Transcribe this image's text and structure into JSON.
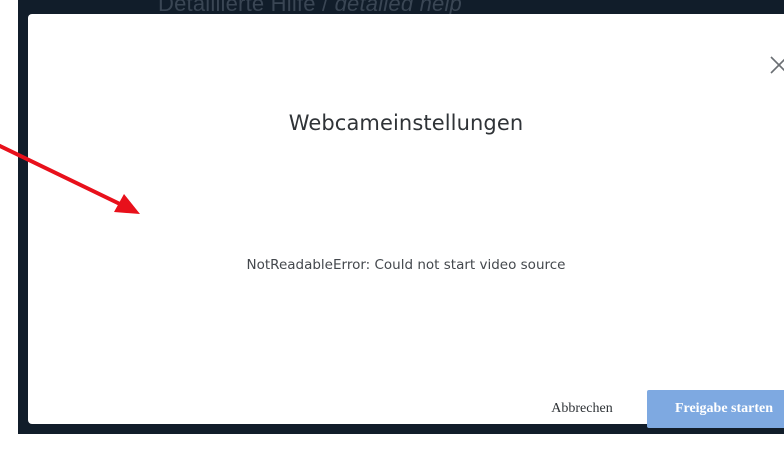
{
  "background": {
    "heading_part1": "Detaillierte Hilfe / ",
    "heading_part2": "detailed help"
  },
  "dialog": {
    "title": "Webcameinstellungen",
    "error_message": "NotReadableError: Could not start video source",
    "cancel_label": "Abbrechen",
    "start_label": "Freigabe starten",
    "close_icon": "close-icon"
  },
  "annotation": {
    "arrow_color": "#e8101b"
  },
  "colors": {
    "primary_button": "#7ea9e1",
    "backdrop": "#111d2a",
    "modal": "#ffffff"
  }
}
